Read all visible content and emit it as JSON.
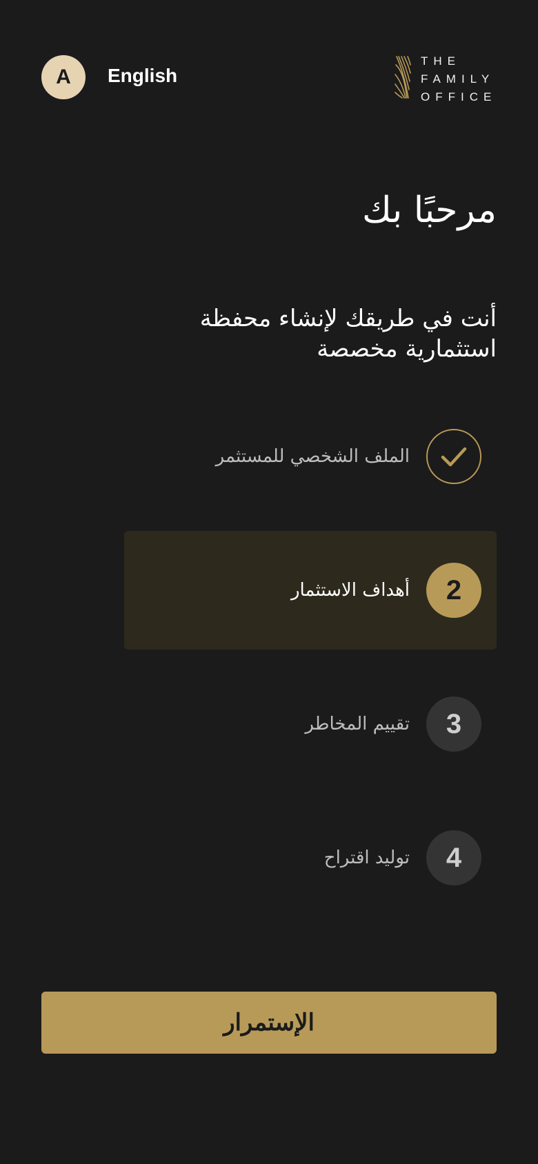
{
  "header": {
    "avatar_letter": "A",
    "language_label": "English",
    "logo": {
      "line1": "THE",
      "line2": "FAMILY",
      "line3": "OFFICE",
      "icon": "palm-leaf-logo-icon",
      "accent": "#b89a58"
    }
  },
  "main": {
    "title": "مرحبًا بك",
    "subtitle": "أنت في طريقك لإنشاء محفظة استثمارية مخصصة"
  },
  "steps": [
    {
      "number": "",
      "label": "الملف الشخصي للمستثمر",
      "status": "completed",
      "icon": "checkmark-icon"
    },
    {
      "number": "2",
      "label": "أهداف الاستثمار",
      "status": "current"
    },
    {
      "number": "3",
      "label": "تقييم المخاطر",
      "status": "pending"
    },
    {
      "number": "4",
      "label": "توليد اقتراح",
      "status": "pending"
    }
  ],
  "footer": {
    "continue_label": "الإستمرار"
  },
  "colors": {
    "background": "#1b1b1b",
    "accent": "#b89a58",
    "active_row": "#2d291d",
    "pending_circle": "#343434",
    "avatar": "#e6d3b2"
  }
}
